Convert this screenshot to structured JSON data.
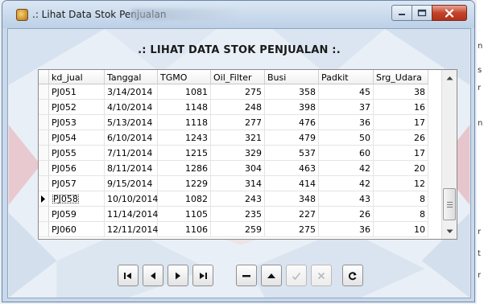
{
  "window": {
    "title": ".: Lihat Data Stok Penjualan"
  },
  "header": {
    "title": ".: LIHAT DATA STOK PENJUALAN :."
  },
  "grid": {
    "columns": [
      "kd_jual",
      "Tanggal",
      "TGMO",
      "Oil_Filter",
      "Busi",
      "Padkit",
      "Srg_Udara"
    ],
    "rows": [
      [
        "PJ051",
        "3/14/2014",
        "1081",
        "275",
        "358",
        "45",
        "38"
      ],
      [
        "PJ052",
        "4/10/2014",
        "1148",
        "248",
        "398",
        "37",
        "16"
      ],
      [
        "PJ053",
        "5/13/2014",
        "1118",
        "277",
        "476",
        "36",
        "17"
      ],
      [
        "PJ054",
        "6/10/2014",
        "1243",
        "321",
        "479",
        "50",
        "26"
      ],
      [
        "PJ055",
        "7/11/2014",
        "1215",
        "329",
        "537",
        "60",
        "17"
      ],
      [
        "PJ056",
        "8/11/2014",
        "1286",
        "304",
        "463",
        "42",
        "20"
      ],
      [
        "PJ057",
        "9/15/2014",
        "1229",
        "314",
        "414",
        "42",
        "12"
      ],
      [
        "PJ058",
        "10/10/2014",
        "1082",
        "243",
        "348",
        "43",
        "8"
      ],
      [
        "PJ059",
        "11/14/2014",
        "1105",
        "235",
        "227",
        "26",
        "8"
      ],
      [
        "PJ060",
        "12/11/2014",
        "1106",
        "259",
        "275",
        "36",
        "10"
      ]
    ],
    "current_row_index": 7
  },
  "navigator": {
    "buttons": [
      {
        "name": "nav-first-button",
        "icon": "first-record-icon",
        "enabled": true
      },
      {
        "name": "nav-prior-button",
        "icon": "prior-record-icon",
        "enabled": true
      },
      {
        "name": "nav-next-button",
        "icon": "next-record-icon",
        "enabled": true
      },
      {
        "name": "nav-last-button",
        "icon": "last-record-icon",
        "enabled": true
      },
      {
        "name": "nav-delete-button",
        "icon": "delete-record-icon",
        "enabled": true
      },
      {
        "name": "nav-edit-button",
        "icon": "edit-record-icon",
        "enabled": true
      },
      {
        "name": "nav-post-button",
        "icon": "post-record-icon",
        "enabled": false
      },
      {
        "name": "nav-cancel-button",
        "icon": "cancel-record-icon",
        "enabled": false
      },
      {
        "name": "nav-refresh-button",
        "icon": "refresh-icon",
        "enabled": true
      }
    ]
  },
  "colors": {
    "titlebar": "#c9d9ea",
    "close_button": "#c4432b",
    "grid_background": "#ffffff"
  },
  "background_edge": {
    "letters": [
      "n",
      "s",
      "r",
      "n",
      "r",
      "t",
      "r"
    ]
  }
}
